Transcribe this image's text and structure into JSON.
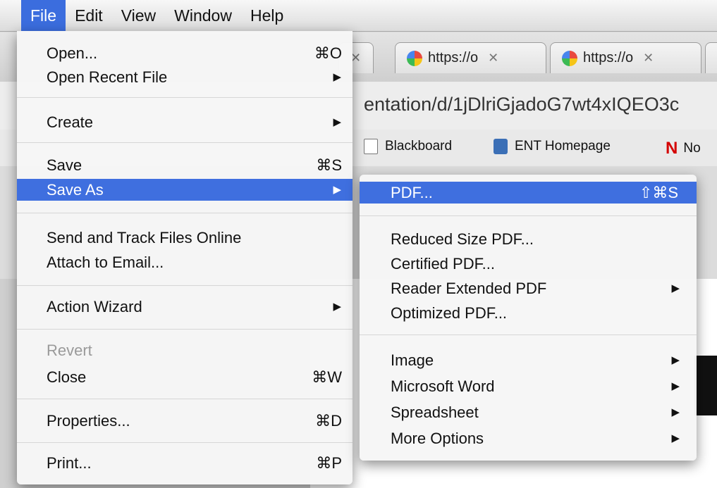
{
  "menubar": {
    "items": [
      "File",
      "Edit",
      "View",
      "Window",
      "Help"
    ],
    "active": "File"
  },
  "browser": {
    "tabs": [
      {
        "title": "https://o"
      },
      {
        "title": "https://o"
      }
    ],
    "url_visible": "entation/d/1jDlriGjadoG7wt4xIQEO3c",
    "bookmarks": [
      {
        "label": "Blackboard",
        "icon": "document-icon"
      },
      {
        "label": "ENT Homepage",
        "icon": "shield-icon"
      },
      {
        "label": "No",
        "icon": "n-logo-icon"
      }
    ]
  },
  "file_menu": {
    "open": {
      "label": "Open...",
      "shortcut": "⌘O"
    },
    "open_recent": {
      "label": "Open Recent File"
    },
    "create": {
      "label": "Create"
    },
    "save": {
      "label": "Save",
      "shortcut": "⌘S"
    },
    "save_as": {
      "label": "Save As"
    },
    "send_track": {
      "label": "Send and Track Files Online"
    },
    "attach_email": {
      "label": "Attach to Email..."
    },
    "action_wizard": {
      "label": "Action Wizard"
    },
    "revert": {
      "label": "Revert"
    },
    "close": {
      "label": "Close",
      "shortcut": "⌘W"
    },
    "properties": {
      "label": "Properties...",
      "shortcut": "⌘D"
    },
    "print": {
      "label": "Print...",
      "shortcut": "⌘P"
    }
  },
  "save_as_menu": {
    "pdf": {
      "label": "PDF...",
      "shortcut": "⇧⌘S"
    },
    "reduced": {
      "label": "Reduced Size PDF..."
    },
    "certified": {
      "label": "Certified PDF..."
    },
    "reader_extended": {
      "label": "Reader Extended PDF"
    },
    "optimized": {
      "label": "Optimized PDF..."
    },
    "image": {
      "label": "Image"
    },
    "word": {
      "label": "Microsoft Word"
    },
    "spreadsheet": {
      "label": "Spreadsheet"
    },
    "more": {
      "label": "More Options"
    }
  },
  "colors": {
    "highlight": "#3f6fdf",
    "menu_bg": "#f6f6f6",
    "disabled_text": "#9a9a9a"
  }
}
